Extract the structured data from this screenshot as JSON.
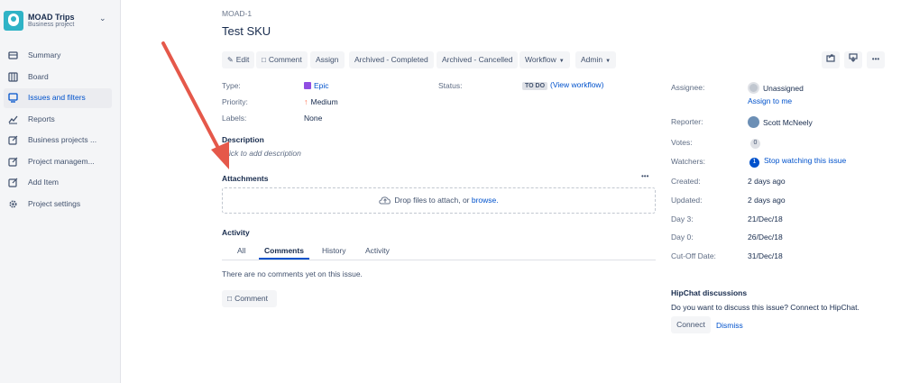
{
  "project": {
    "name": "MOAD Trips",
    "type": "Business project"
  },
  "sidebar": {
    "items": [
      {
        "label": "Summary",
        "icon": "summary-icon"
      },
      {
        "label": "Board",
        "icon": "board-icon"
      },
      {
        "label": "Issues and filters",
        "icon": "issues-icon",
        "active": true
      },
      {
        "label": "Reports",
        "icon": "reports-icon"
      },
      {
        "label": "Business projects ...",
        "icon": "shortcut-icon"
      },
      {
        "label": "Project managem...",
        "icon": "shortcut-icon"
      },
      {
        "label": "Add Item",
        "icon": "shortcut-icon"
      },
      {
        "label": "Project settings",
        "icon": "gear-icon"
      }
    ]
  },
  "issue": {
    "key": "MOAD-1",
    "title": "Test SKU"
  },
  "toolbar": {
    "edit": "Edit",
    "comment": "Comment",
    "assign": "Assign",
    "archived_completed": "Archived - Completed",
    "archived_cancelled": "Archived - Cancelled",
    "workflow": "Workflow",
    "admin": "Admin",
    "more": "•••"
  },
  "details": {
    "type_label": "Type:",
    "type_value": "Epic",
    "priority_label": "Priority:",
    "priority_value": "Medium",
    "labels_label": "Labels:",
    "labels_value": "None",
    "status_label": "Status:",
    "status_value": "TO DO",
    "view_workflow": "(View workflow)"
  },
  "description": {
    "heading": "Description",
    "placeholder": "Click to add description"
  },
  "attachments": {
    "heading": "Attachments",
    "more": "•••",
    "drop_text": "Drop files to attach, or ",
    "browse": "browse."
  },
  "activity": {
    "heading": "Activity",
    "tabs": [
      "All",
      "Comments",
      "History",
      "Activity"
    ],
    "active_tab": "Comments",
    "empty": "There are no comments yet on this issue.",
    "comment_button": "Comment"
  },
  "people": {
    "assignee_label": "Assignee:",
    "assignee_value": "Unassigned",
    "assign_to_me": "Assign to me",
    "reporter_label": "Reporter:",
    "reporter_value": "Scott McNeely",
    "votes_label": "Votes:",
    "votes_count": "0",
    "watchers_label": "Watchers:",
    "watchers_count": "1",
    "stop_watching": "Stop watching this issue"
  },
  "dates": [
    {
      "label": "Created:",
      "value": "2 days ago"
    },
    {
      "label": "Updated:",
      "value": "2 days ago"
    },
    {
      "label": "Day 3:",
      "value": "21/Dec/18"
    },
    {
      "label": "Day 0:",
      "value": "26/Dec/18"
    },
    {
      "label": "Cut-Off Date:",
      "value": "31/Dec/18"
    }
  ],
  "hipchat": {
    "heading": "HipChat discussions",
    "text": "Do you want to discuss this issue? Connect to HipChat.",
    "connect": "Connect",
    "dismiss": "Dismiss"
  },
  "colors": {
    "accent": "#0052cc",
    "annotation_arrow": "#e5584a",
    "sidebar_bg": "#f4f5f7"
  }
}
